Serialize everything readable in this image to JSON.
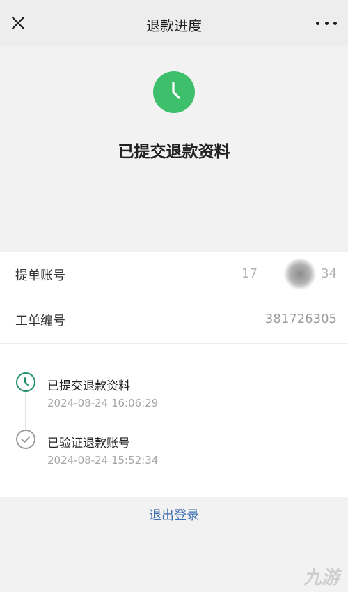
{
  "header": {
    "title": "退款进度",
    "close_icon": "close-icon",
    "more_icon": "more-icon"
  },
  "status": {
    "icon": "clock-icon",
    "icon_color": "#3dbf6b",
    "title": "已提交退款资料"
  },
  "info": {
    "rows": [
      {
        "label": "提单账号",
        "value_start": "17",
        "value_end": "34"
      },
      {
        "label": "工单编号",
        "value": "381726305"
      }
    ]
  },
  "timeline": {
    "steps": [
      {
        "title": "已提交退款资料",
        "time": "2024-08-24 16:06:29",
        "icon": "clock-icon",
        "state": "active"
      },
      {
        "title": "已验证退款账号",
        "time": "2024-08-24 15:52:34",
        "icon": "check-icon",
        "state": "done"
      }
    ]
  },
  "footer": {
    "logout_label": "退出登录",
    "watermark": "九游",
    "accent_color": "#3c6eb0"
  }
}
